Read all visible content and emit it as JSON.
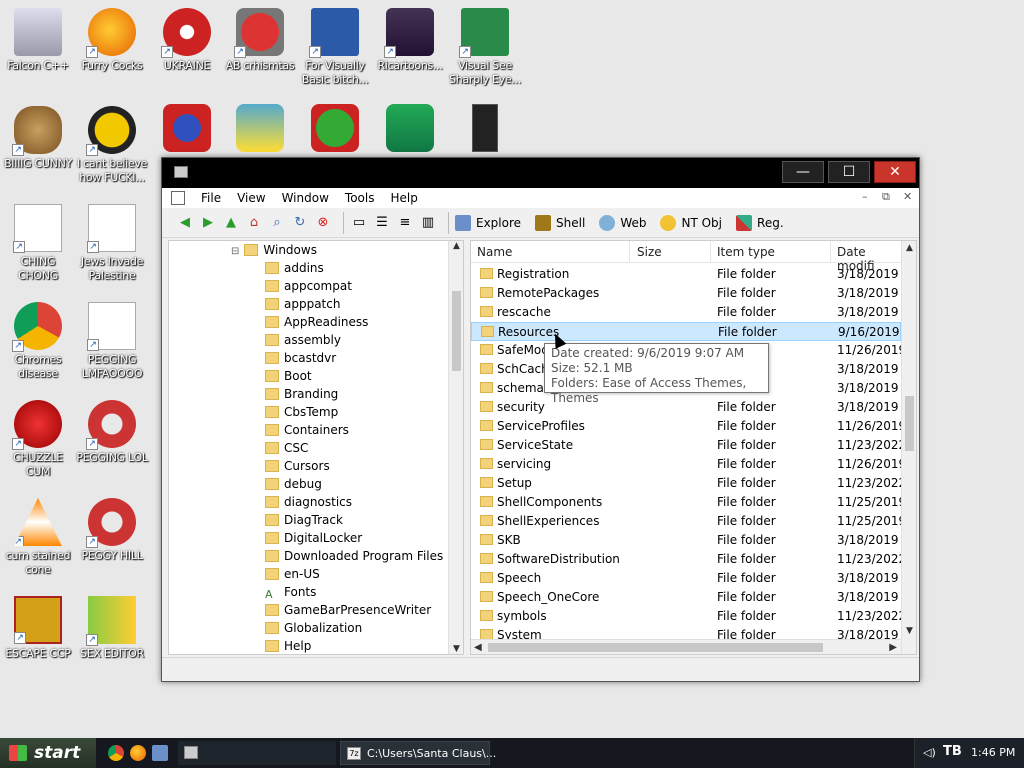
{
  "desktop": {
    "icons": [
      {
        "label": "Falcon C++"
      },
      {
        "label": "Furry Cocks"
      },
      {
        "label": "UKRAINE"
      },
      {
        "label": "AB crhismtas"
      },
      {
        "label": "For Visually Basic bitch..."
      },
      {
        "label": "Ricartoons..."
      },
      {
        "label": "Visual See Sharply Eye..."
      },
      {
        "label": "BIIIIG CUNNY"
      },
      {
        "label": "I cant believe how FUCKI..."
      },
      {
        "label": "CHING CHONG"
      },
      {
        "label": "Jews Invade Palestine"
      },
      {
        "label": "Chromes disease"
      },
      {
        "label": "PEGGING LMFAOOOO"
      },
      {
        "label": "CHUZZLE CUM"
      },
      {
        "label": "PEGGING LOL"
      },
      {
        "label": "cum stained cone"
      },
      {
        "label": "PEGGY HILL"
      },
      {
        "label": "ESCAPE CCP"
      },
      {
        "label": "SEX EDITOR"
      }
    ]
  },
  "window": {
    "menu": [
      "File",
      "View",
      "Window",
      "Tools",
      "Help"
    ],
    "toolbar_labels": [
      "Explore",
      "Shell",
      "Web",
      "NT Obj",
      "Reg."
    ],
    "tree_root": "Windows",
    "tree_items": [
      "addins",
      "appcompat",
      "apppatch",
      "AppReadiness",
      "assembly",
      "bcastdvr",
      "Boot",
      "Branding",
      "CbsTemp",
      "Containers",
      "CSC",
      "Cursors",
      "debug",
      "diagnostics",
      "DiagTrack",
      "DigitalLocker",
      "Downloaded Program Files",
      "en-US",
      "Fonts",
      "GameBarPresenceWriter",
      "Globalization",
      "Help"
    ],
    "columns": {
      "name": "Name",
      "size": "Size",
      "type": "Item type",
      "date": "Date modifi"
    },
    "files": [
      {
        "name": "Registration",
        "type": "File folder",
        "date": "3/18/2019 9"
      },
      {
        "name": "RemotePackages",
        "type": "File folder",
        "date": "3/18/2019 1"
      },
      {
        "name": "rescache",
        "type": "File folder",
        "date": "3/18/2019 9"
      },
      {
        "name": "Resources",
        "type": "File folder",
        "date": "9/16/2019 1"
      },
      {
        "name": "SafeMode",
        "type": "",
        "date": "11/26/2019"
      },
      {
        "name": "SchCache",
        "type": "",
        "date": "3/18/2019 9"
      },
      {
        "name": "schemas",
        "type": "",
        "date": "3/18/2019 9"
      },
      {
        "name": "security",
        "type": "File folder",
        "date": "3/18/2019 1"
      },
      {
        "name": "ServiceProfiles",
        "type": "File folder",
        "date": "11/26/2019"
      },
      {
        "name": "ServiceState",
        "type": "File folder",
        "date": "11/23/2022"
      },
      {
        "name": "servicing",
        "type": "File folder",
        "date": "11/26/2019"
      },
      {
        "name": "Setup",
        "type": "File folder",
        "date": "11/23/2022"
      },
      {
        "name": "ShellComponents",
        "type": "File folder",
        "date": "11/25/2019"
      },
      {
        "name": "ShellExperiences",
        "type": "File folder",
        "date": "11/25/2019"
      },
      {
        "name": "SKB",
        "type": "File folder",
        "date": "3/18/2019 9"
      },
      {
        "name": "SoftwareDistribution",
        "type": "File folder",
        "date": "11/23/2022"
      },
      {
        "name": "Speech",
        "type": "File folder",
        "date": "3/18/2019 9"
      },
      {
        "name": "Speech_OneCore",
        "type": "File folder",
        "date": "3/18/2019 9"
      },
      {
        "name": "symbols",
        "type": "File folder",
        "date": "11/23/2022"
      },
      {
        "name": "System",
        "type": "File folder",
        "date": "3/18/2019 9"
      }
    ],
    "selected_index": 3,
    "tooltip": {
      "line1": "Date created: 9/6/2019 9:07 AM",
      "line2": "Size: 52.1 MB",
      "line3": "Folders: Ease of Access Themes, Themes"
    }
  },
  "taskbar": {
    "start_label": "start",
    "task_label": "C:\\Users\\Santa Claus\\...",
    "clock": "1:46 PM"
  }
}
